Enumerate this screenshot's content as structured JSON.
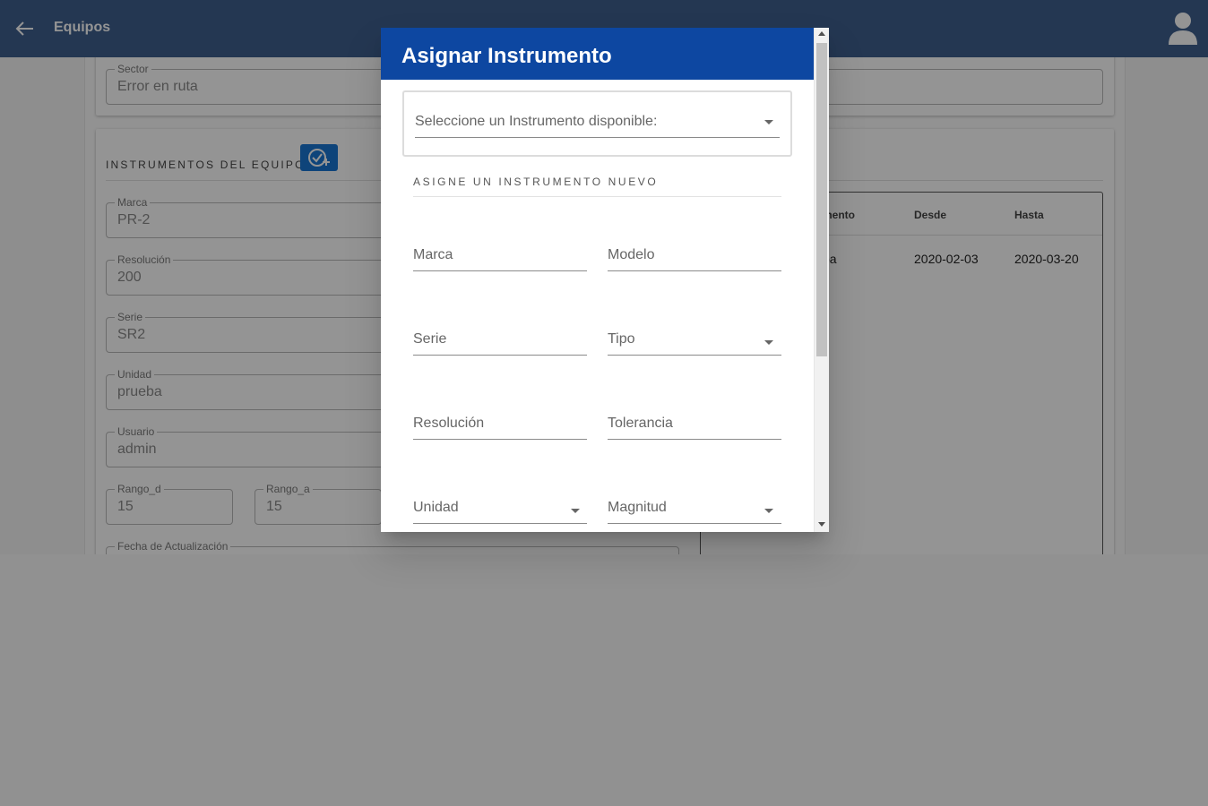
{
  "topbar": {
    "title": "Equipos"
  },
  "sector": {
    "label": "Sector",
    "value": "Error en ruta"
  },
  "instruments_section": {
    "title": "INSTRUMENTOS DEL EQUIPO",
    "fields": [
      {
        "label": "Marca",
        "value": "PR-2"
      },
      {
        "label": "Resolución",
        "value": "200"
      },
      {
        "label": "Serie",
        "value": "SR2"
      },
      {
        "label": "Unidad",
        "value": "prueba"
      },
      {
        "label": "Usuario",
        "value": "admin"
      }
    ],
    "rango_d": {
      "label": "Rango_d",
      "value": "15"
    },
    "rango_a": {
      "label": "Rango_a",
      "value": "15"
    },
    "fecha": {
      "label": "Fecha de Actualización",
      "value": ""
    }
  },
  "history_table": {
    "columns": [
      "mento",
      "Desde",
      "Hasta"
    ],
    "rows": [
      {
        "instrumento": "ba",
        "desde": "2020-02-03",
        "hasta": "2020-03-20"
      }
    ]
  },
  "dialog": {
    "title": "Asignar Instrumento",
    "available_select_label": "Seleccione un Instrumento disponible:",
    "new_section_title": "ASIGNE UN INSTRUMENTO NUEVO",
    "fields": {
      "marca": "Marca",
      "modelo": "Modelo",
      "serie": "Serie",
      "tipo": "Tipo",
      "resolucion": "Resolución",
      "tolerancia": "Tolerancia",
      "unidad": "Unidad",
      "magnitud": "Magnitud"
    }
  },
  "colors": {
    "topbar": "#3f5f8e",
    "dialog_header": "#0d47a1",
    "accent_button": "#1976d2"
  }
}
